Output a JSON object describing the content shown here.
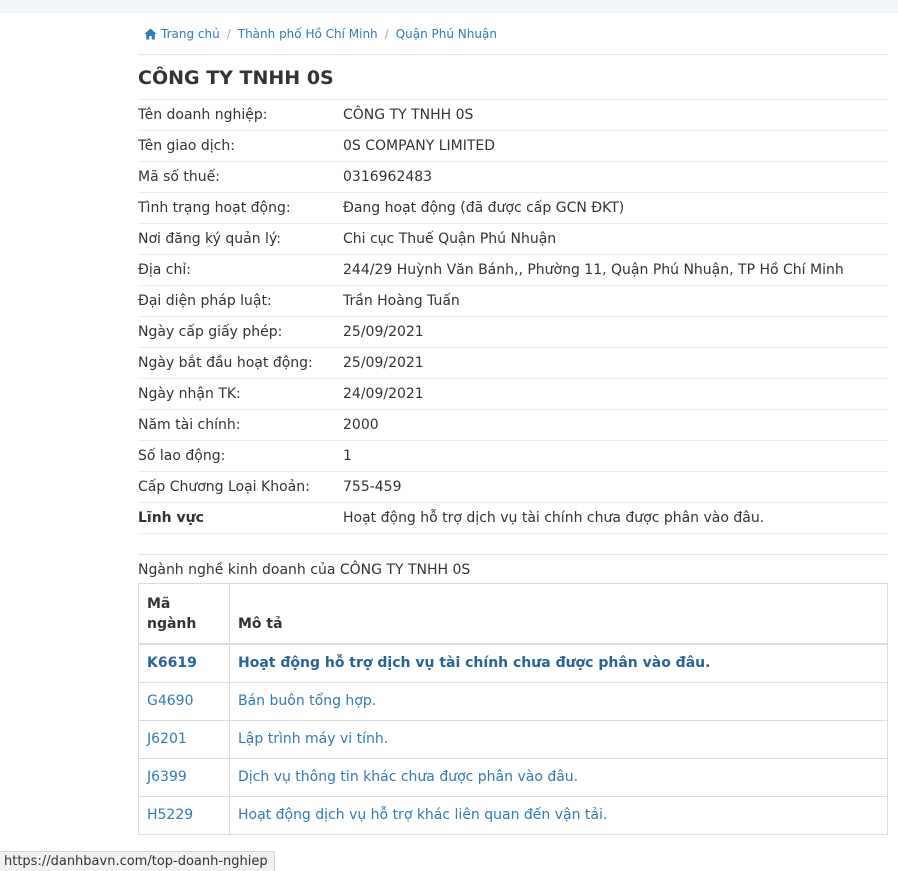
{
  "breadcrumb": {
    "home": "Trang chủ",
    "city": "Thành phố Hồ Chí Minh",
    "district": "Quận Phú Nhuận"
  },
  "company": {
    "title": "CÔNG TY TNHH 0S",
    "fields": [
      {
        "label": "Tên doanh nghiệp:",
        "value": "CÔNG TY TNHH 0S"
      },
      {
        "label": "Tên giao dịch:",
        "value": "0S COMPANY LIMITED"
      },
      {
        "label": "Mã số thuế:",
        "value": "0316962483"
      },
      {
        "label": "Tình trạng hoạt động:",
        "value": "Đang hoạt động (đã được cấp GCN ĐKT)"
      },
      {
        "label": "Nơi đăng ký quản lý:",
        "value": "Chi cục Thuế Quận Phú Nhuận"
      },
      {
        "label": "Địa chỉ:",
        "value": "244/29 Huỳnh Văn Bánh,, Phường 11, Quận Phú Nhuận, TP Hồ Chí Minh"
      },
      {
        "label": "Đại diện pháp luật:",
        "value": "Trần Hoàng Tuấn"
      },
      {
        "label": "Ngày cấp giấy phép:",
        "value": "25/09/2021"
      },
      {
        "label": "Ngày bắt đầu hoạt động:",
        "value": "25/09/2021"
      },
      {
        "label": "Ngày nhận TK:",
        "value": "24/09/2021"
      },
      {
        "label": "Năm tài chính:",
        "value": "2000"
      },
      {
        "label": "Số lao động:",
        "value": "1"
      },
      {
        "label": "Cấp Chương Loại Khoản:",
        "value": "755-459"
      },
      {
        "label": "Lĩnh vực",
        "value": "Hoạt động hỗ trợ dịch vụ tài chính chưa được phân vào đâu."
      }
    ]
  },
  "industries": {
    "heading": "Ngành nghề kinh doanh của CÔNG TY TNHH 0S",
    "col_code": "Mã ngành",
    "col_desc": "Mô tả",
    "rows": [
      {
        "code": "K6619",
        "desc": "Hoạt động hỗ trợ dịch vụ tài chính chưa được phân vào đâu."
      },
      {
        "code": "G4690",
        "desc": "Bán buôn tổng hợp."
      },
      {
        "code": "J6201",
        "desc": "Lập trình máy vi tính."
      },
      {
        "code": "J6399",
        "desc": "Dịch vụ thông tin khác chưa được phân vào đâu."
      },
      {
        "code": "H5229",
        "desc": "Hoạt động dịch vụ hỗ trợ khác liên quan đến vận tải."
      }
    ]
  },
  "status_bar": {
    "url": "https://danhbavn.com/top-doanh-nghiep"
  },
  "icons": {
    "home": "home-icon"
  },
  "colors": {
    "link": "#337ab7",
    "primary_row": "#2a6496"
  }
}
